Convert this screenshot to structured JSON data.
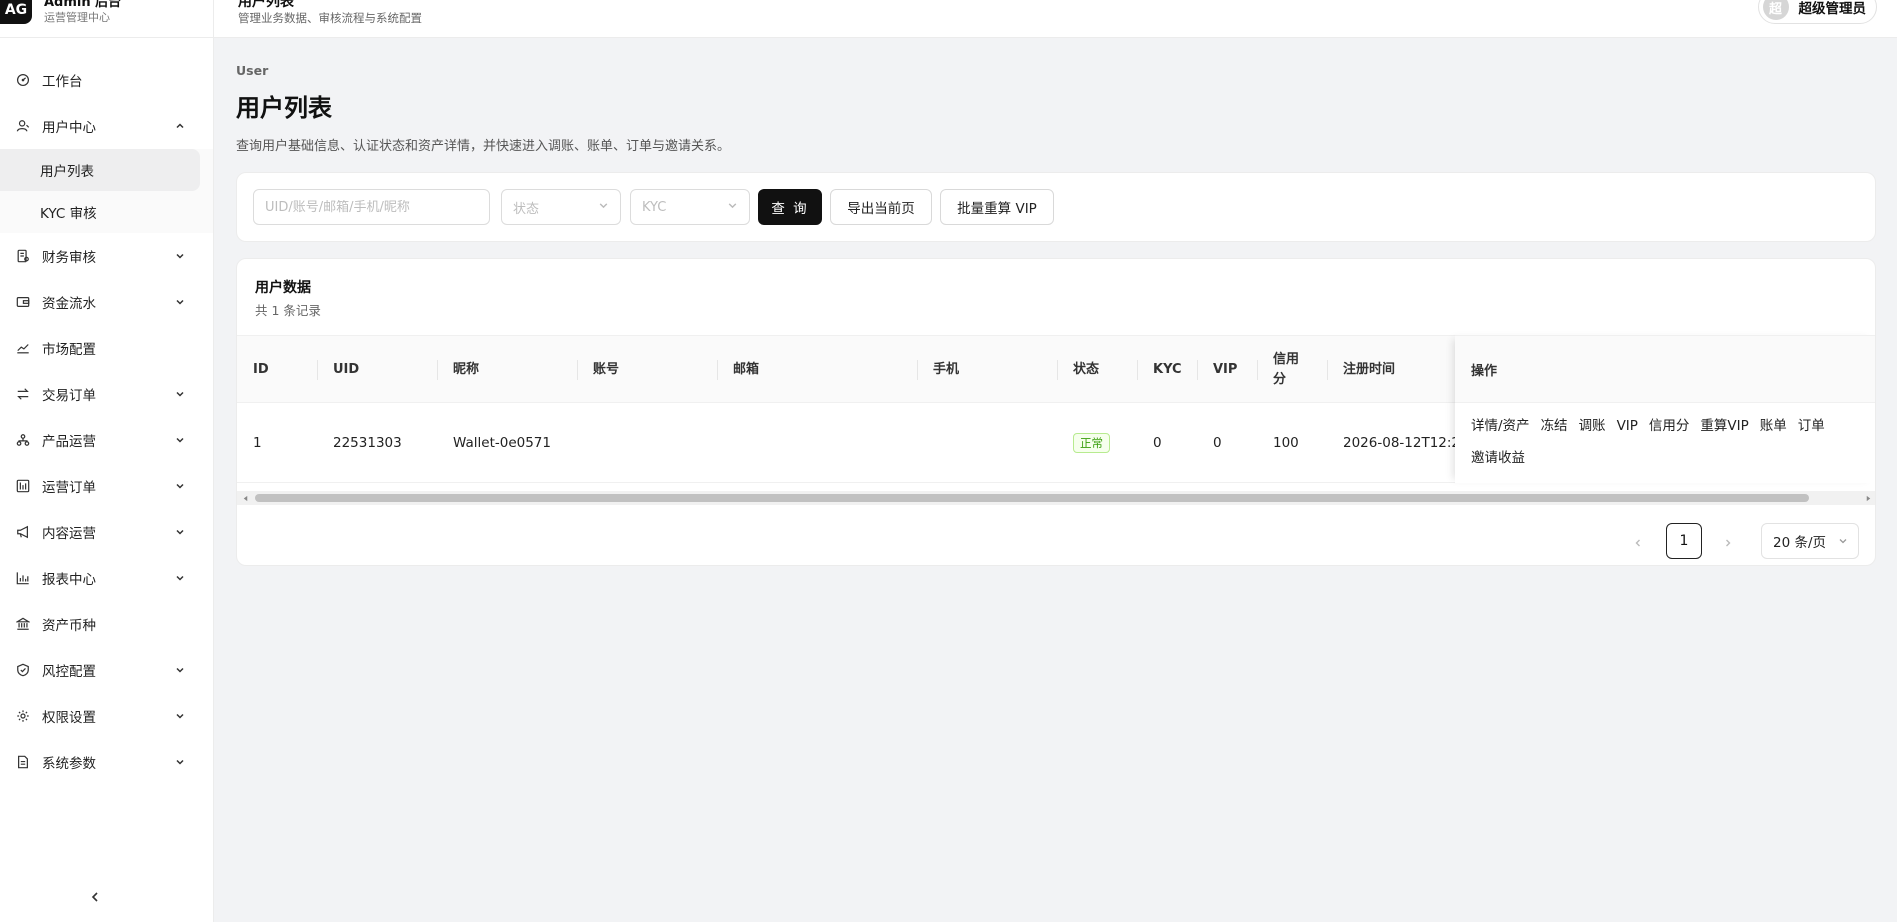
{
  "brand": {
    "logo_text": "AG",
    "title": "Admin 后台",
    "subtitle": "运营管理中心"
  },
  "header": {
    "title": "用户列表",
    "subtitle": "管理业务数据、审核流程与系统配置"
  },
  "user": {
    "avatar_text": "超",
    "name": "超级管理员"
  },
  "sidebar": {
    "items": [
      {
        "label": "工作台",
        "icon": "dashboard-icon"
      },
      {
        "label": "用户中心",
        "icon": "user-icon",
        "expanded": true
      },
      {
        "label": "财务审核",
        "icon": "finance-review-icon"
      },
      {
        "label": "资金流水",
        "icon": "wallet-icon"
      },
      {
        "label": "市场配置",
        "icon": "market-chart-icon"
      },
      {
        "label": "交易订单",
        "icon": "exchange-icon"
      },
      {
        "label": "产品运营",
        "icon": "product-icon"
      },
      {
        "label": "运营订单",
        "icon": "ops-order-icon"
      },
      {
        "label": "内容运营",
        "icon": "megaphone-icon"
      },
      {
        "label": "报表中心",
        "icon": "bar-chart-icon"
      },
      {
        "label": "资产币种",
        "icon": "bank-icon"
      },
      {
        "label": "风控配置",
        "icon": "shield-icon"
      },
      {
        "label": "权限设置",
        "icon": "gear-icon"
      },
      {
        "label": "系统参数",
        "icon": "document-icon"
      }
    ],
    "submenu": [
      {
        "label": "用户列表",
        "active": true
      },
      {
        "label": "KYC 审核",
        "active": false
      }
    ]
  },
  "page": {
    "breadcrumb": "User",
    "title": "用户列表",
    "description": "查询用户基础信息、认证状态和资产详情，并快速进入调账、账单、订单与邀请关系。"
  },
  "filters": {
    "search_placeholder": "UID/账号/邮箱/手机/昵称",
    "status_placeholder": "状态",
    "kyc_placeholder": "KYC",
    "query_label": "查 询",
    "export_label": "导出当前页",
    "batch_vip_label": "批量重算 VIP"
  },
  "table": {
    "title": "用户数据",
    "count_text": "共 1 条记录",
    "columns": [
      "ID",
      "UID",
      "昵称",
      "账号",
      "邮箱",
      "手机",
      "状态",
      "KYC",
      "VIP",
      "信用\n分",
      "注册时间",
      "操作"
    ],
    "rows": [
      {
        "id": "1",
        "uid": "22531303",
        "nickname": "Wallet-0e0571",
        "account": "",
        "email": "",
        "phone": "",
        "status": "正常",
        "kyc": "0",
        "vip": "0",
        "credit": "100",
        "registered": "2026-08-12T12:2",
        "actions": [
          "详情/资产",
          "冻结",
          "调账",
          "VIP",
          "信用分",
          "重算VIP",
          "账单",
          "订单",
          "邀请收益"
        ]
      }
    ]
  },
  "pagination": {
    "current_page": "1",
    "page_size_label": "20 条/页"
  },
  "colors": {
    "primary": "#111111",
    "status_ok": "#389e0d",
    "background": "#f2f3f5"
  }
}
